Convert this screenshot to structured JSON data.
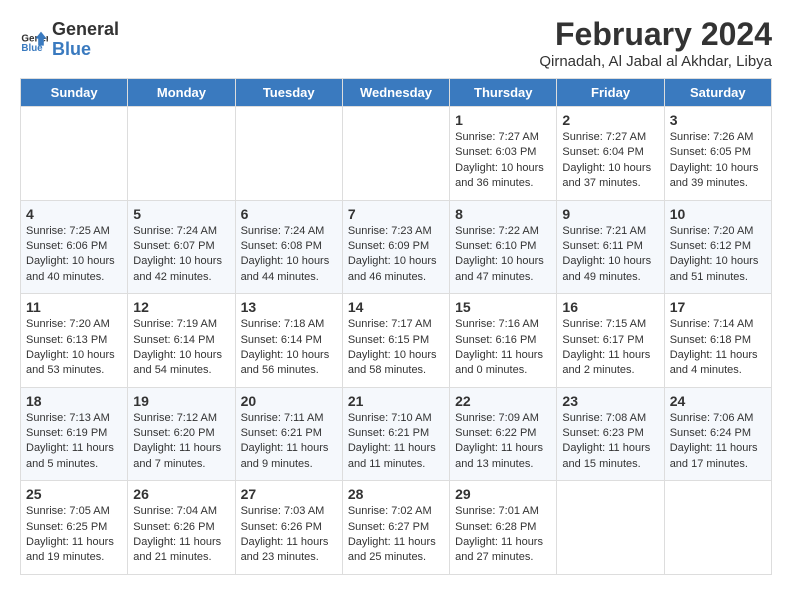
{
  "logo": {
    "line1": "General",
    "line2": "Blue"
  },
  "title": "February 2024",
  "subtitle": "Qirnadah, Al Jabal al Akhdar, Libya",
  "days_header": [
    "Sunday",
    "Monday",
    "Tuesday",
    "Wednesday",
    "Thursday",
    "Friday",
    "Saturday"
  ],
  "weeks": [
    [
      {
        "day": "",
        "content": ""
      },
      {
        "day": "",
        "content": ""
      },
      {
        "day": "",
        "content": ""
      },
      {
        "day": "",
        "content": ""
      },
      {
        "day": "1",
        "content": "Sunrise: 7:27 AM\nSunset: 6:03 PM\nDaylight: 10 hours\nand 36 minutes."
      },
      {
        "day": "2",
        "content": "Sunrise: 7:27 AM\nSunset: 6:04 PM\nDaylight: 10 hours\nand 37 minutes."
      },
      {
        "day": "3",
        "content": "Sunrise: 7:26 AM\nSunset: 6:05 PM\nDaylight: 10 hours\nand 39 minutes."
      }
    ],
    [
      {
        "day": "4",
        "content": "Sunrise: 7:25 AM\nSunset: 6:06 PM\nDaylight: 10 hours\nand 40 minutes."
      },
      {
        "day": "5",
        "content": "Sunrise: 7:24 AM\nSunset: 6:07 PM\nDaylight: 10 hours\nand 42 minutes."
      },
      {
        "day": "6",
        "content": "Sunrise: 7:24 AM\nSunset: 6:08 PM\nDaylight: 10 hours\nand 44 minutes."
      },
      {
        "day": "7",
        "content": "Sunrise: 7:23 AM\nSunset: 6:09 PM\nDaylight: 10 hours\nand 46 minutes."
      },
      {
        "day": "8",
        "content": "Sunrise: 7:22 AM\nSunset: 6:10 PM\nDaylight: 10 hours\nand 47 minutes."
      },
      {
        "day": "9",
        "content": "Sunrise: 7:21 AM\nSunset: 6:11 PM\nDaylight: 10 hours\nand 49 minutes."
      },
      {
        "day": "10",
        "content": "Sunrise: 7:20 AM\nSunset: 6:12 PM\nDaylight: 10 hours\nand 51 minutes."
      }
    ],
    [
      {
        "day": "11",
        "content": "Sunrise: 7:20 AM\nSunset: 6:13 PM\nDaylight: 10 hours\nand 53 minutes."
      },
      {
        "day": "12",
        "content": "Sunrise: 7:19 AM\nSunset: 6:14 PM\nDaylight: 10 hours\nand 54 minutes."
      },
      {
        "day": "13",
        "content": "Sunrise: 7:18 AM\nSunset: 6:14 PM\nDaylight: 10 hours\nand 56 minutes."
      },
      {
        "day": "14",
        "content": "Sunrise: 7:17 AM\nSunset: 6:15 PM\nDaylight: 10 hours\nand 58 minutes."
      },
      {
        "day": "15",
        "content": "Sunrise: 7:16 AM\nSunset: 6:16 PM\nDaylight: 11 hours\nand 0 minutes."
      },
      {
        "day": "16",
        "content": "Sunrise: 7:15 AM\nSunset: 6:17 PM\nDaylight: 11 hours\nand 2 minutes."
      },
      {
        "day": "17",
        "content": "Sunrise: 7:14 AM\nSunset: 6:18 PM\nDaylight: 11 hours\nand 4 minutes."
      }
    ],
    [
      {
        "day": "18",
        "content": "Sunrise: 7:13 AM\nSunset: 6:19 PM\nDaylight: 11 hours\nand 5 minutes."
      },
      {
        "day": "19",
        "content": "Sunrise: 7:12 AM\nSunset: 6:20 PM\nDaylight: 11 hours\nand 7 minutes."
      },
      {
        "day": "20",
        "content": "Sunrise: 7:11 AM\nSunset: 6:21 PM\nDaylight: 11 hours\nand 9 minutes."
      },
      {
        "day": "21",
        "content": "Sunrise: 7:10 AM\nSunset: 6:21 PM\nDaylight: 11 hours\nand 11 minutes."
      },
      {
        "day": "22",
        "content": "Sunrise: 7:09 AM\nSunset: 6:22 PM\nDaylight: 11 hours\nand 13 minutes."
      },
      {
        "day": "23",
        "content": "Sunrise: 7:08 AM\nSunset: 6:23 PM\nDaylight: 11 hours\nand 15 minutes."
      },
      {
        "day": "24",
        "content": "Sunrise: 7:06 AM\nSunset: 6:24 PM\nDaylight: 11 hours\nand 17 minutes."
      }
    ],
    [
      {
        "day": "25",
        "content": "Sunrise: 7:05 AM\nSunset: 6:25 PM\nDaylight: 11 hours\nand 19 minutes."
      },
      {
        "day": "26",
        "content": "Sunrise: 7:04 AM\nSunset: 6:26 PM\nDaylight: 11 hours\nand 21 minutes."
      },
      {
        "day": "27",
        "content": "Sunrise: 7:03 AM\nSunset: 6:26 PM\nDaylight: 11 hours\nand 23 minutes."
      },
      {
        "day": "28",
        "content": "Sunrise: 7:02 AM\nSunset: 6:27 PM\nDaylight: 11 hours\nand 25 minutes."
      },
      {
        "day": "29",
        "content": "Sunrise: 7:01 AM\nSunset: 6:28 PM\nDaylight: 11 hours\nand 27 minutes."
      },
      {
        "day": "",
        "content": ""
      },
      {
        "day": "",
        "content": ""
      }
    ]
  ]
}
